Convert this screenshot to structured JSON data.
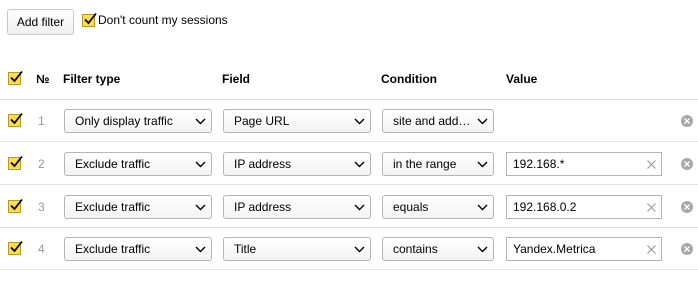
{
  "toolbar": {
    "add_filter_label": "Add filter",
    "dont_count_label": "Don't count my sessions",
    "dont_count_checked": true
  },
  "table": {
    "headers": {
      "number": "№",
      "filter_type": "Filter type",
      "field": "Field",
      "condition": "Condition",
      "value": "Value"
    },
    "rows": [
      {
        "checked": true,
        "number": "1",
        "filter_type": "Only display traffic",
        "field": "Page URL",
        "condition": "site and addit…",
        "value": null
      },
      {
        "checked": true,
        "number": "2",
        "filter_type": "Exclude traffic",
        "field": "IP address",
        "condition": "in the range",
        "value": "192.168.*"
      },
      {
        "checked": true,
        "number": "3",
        "filter_type": "Exclude traffic",
        "field": "IP address",
        "condition": "equals",
        "value": "192.168.0.2"
      },
      {
        "checked": true,
        "number": "4",
        "filter_type": "Exclude traffic",
        "field": "Title",
        "condition": "contains",
        "value": "Yandex.Metrica"
      }
    ]
  },
  "colors": {
    "checkbox_fill": "#ffdb4d",
    "border": "#b5b5b5",
    "row_divider": "#e3e3e3",
    "delete_icon": "#a8a8a8"
  }
}
